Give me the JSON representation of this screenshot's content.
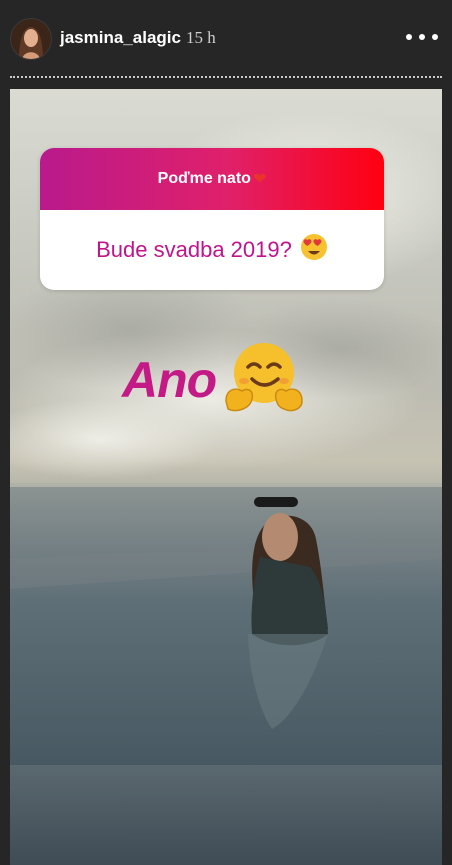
{
  "header": {
    "username": "jasmina_alagic",
    "timestamp": "15 h",
    "avatar_icon": "profile-avatar",
    "more_icon": "more-options-icon"
  },
  "question_sticker": {
    "prompt": "Poďme nato",
    "prompt_icon": "heart",
    "question": "Bude svadba 2019?",
    "question_emoji": "heart-eyes-face",
    "gradient": [
      "#b91a8c",
      "#ff0010"
    ],
    "question_color": "#c0148c"
  },
  "answer": {
    "text": "Ano",
    "emoji": "hugging-face",
    "color": "#c41a86"
  }
}
